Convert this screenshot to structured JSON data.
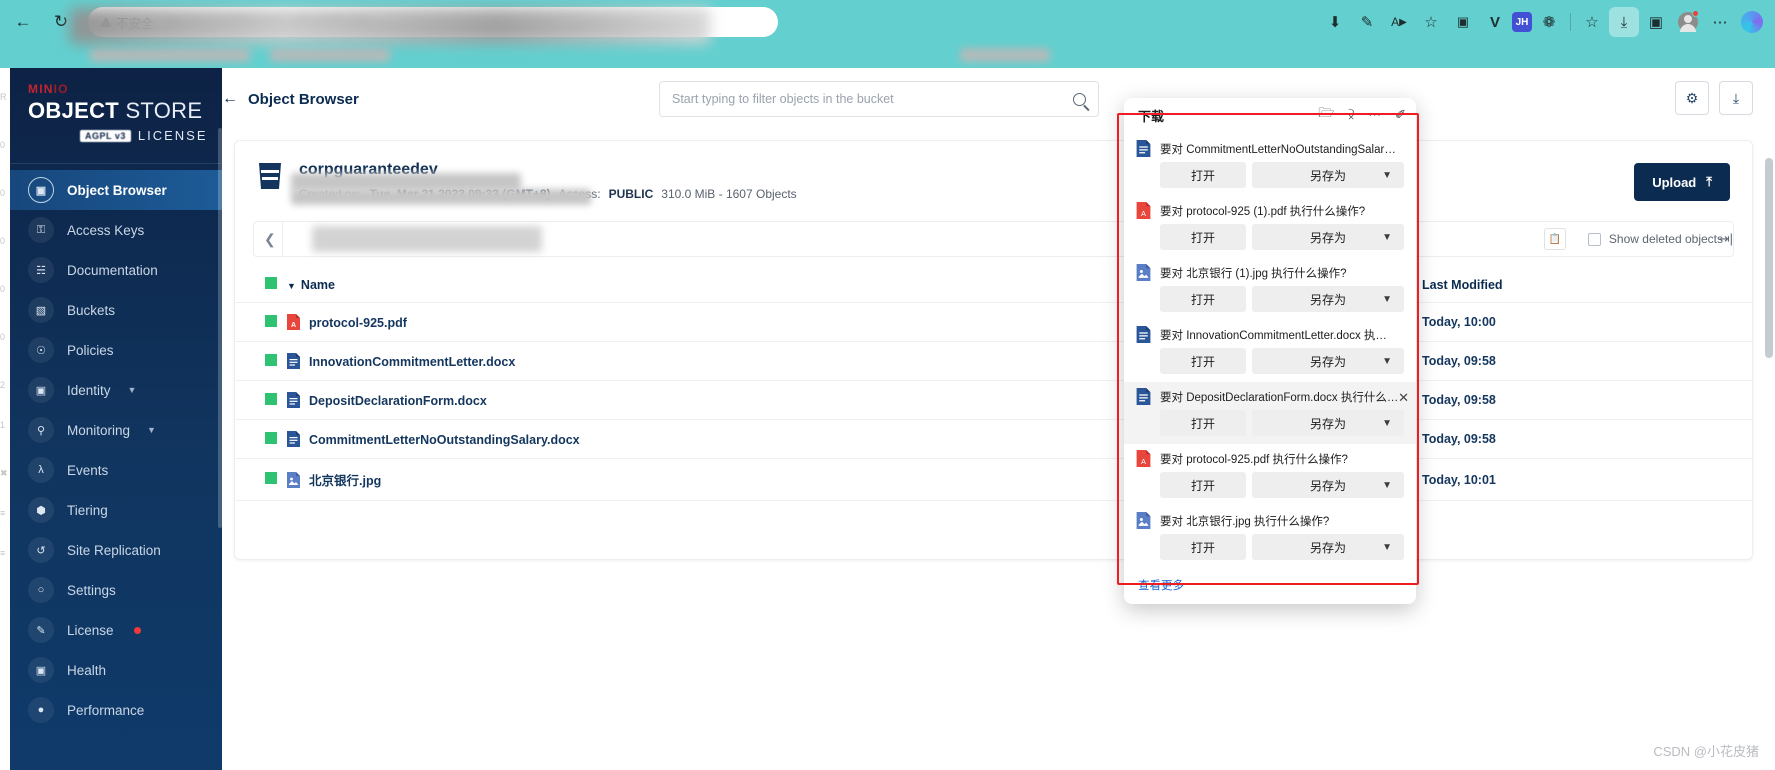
{
  "browser": {
    "nav": {
      "back": "←",
      "forward": "→",
      "reload": "↻"
    },
    "omnibox": {
      "security_label": "不安全",
      "url_text": "xxx.xxx.xxx/d3lel+elJs+aKneWGnQm...",
      "tab_hint": ""
    },
    "toolbar_icons": [
      {
        "name": "download-line-icon",
        "glyph": "⬇"
      },
      {
        "name": "pen-icon",
        "glyph": "✎"
      },
      {
        "name": "read-aloud-icon",
        "glyph": "Aᵛ"
      },
      {
        "name": "favorite-star-icon",
        "glyph": "☆"
      },
      {
        "name": "collections-icon",
        "glyph": "◱"
      },
      {
        "name": "v-extension-icon",
        "glyph": "V"
      },
      {
        "name": "jh-extension-icon",
        "glyph": "JH"
      },
      {
        "name": "puzzle-extension-icon",
        "glyph": "❁"
      },
      {
        "name": "split-screen-icon",
        "glyph": "☆"
      },
      {
        "name": "downloads-icon",
        "glyph": "⤓"
      },
      {
        "name": "browser-essentials-icon",
        "glyph": "▣"
      },
      {
        "name": "profile-avatar",
        "glyph": ""
      },
      {
        "name": "more-options-icon",
        "glyph": "⋯"
      },
      {
        "name": "copilot-icon",
        "glyph": ""
      }
    ]
  },
  "sidebar": {
    "brand": {
      "minio": "MIN",
      "minio_io": "IO",
      "title_bold": "OBJECT",
      "title_light": " STORE",
      "license_tag": "AGPL v3",
      "license_word": "LICENSE"
    },
    "items": [
      {
        "label": "Object Browser",
        "icon": "object-browser-icon",
        "active": true,
        "expandable": false,
        "dot": false
      },
      {
        "label": "Access Keys",
        "icon": "key-icon",
        "active": false,
        "expandable": false,
        "dot": false
      },
      {
        "label": "Documentation",
        "icon": "book-icon",
        "active": false,
        "expandable": false,
        "dot": false
      },
      {
        "label": "Buckets",
        "icon": "bucket-icon",
        "active": false,
        "expandable": false,
        "dot": false
      },
      {
        "label": "Policies",
        "icon": "policy-icon",
        "active": false,
        "expandable": false,
        "dot": false
      },
      {
        "label": "Identity",
        "icon": "identity-icon",
        "active": false,
        "expandable": true,
        "dot": false
      },
      {
        "label": "Monitoring",
        "icon": "monitoring-icon",
        "active": false,
        "expandable": true,
        "dot": false
      },
      {
        "label": "Events",
        "icon": "lambda-icon",
        "active": false,
        "expandable": false,
        "dot": false
      },
      {
        "label": "Tiering",
        "icon": "tiering-icon",
        "active": false,
        "expandable": false,
        "dot": false
      },
      {
        "label": "Site Replication",
        "icon": "replication-icon",
        "active": false,
        "expandable": false,
        "dot": false
      },
      {
        "label": "Settings",
        "icon": "gear-icon",
        "active": false,
        "expandable": false,
        "dot": false
      },
      {
        "label": "License",
        "icon": "license-icon",
        "active": false,
        "expandable": false,
        "dot": true
      },
      {
        "label": "Health",
        "icon": "health-icon",
        "active": false,
        "expandable": false,
        "dot": false
      },
      {
        "label": "Performance",
        "icon": "performance-icon",
        "active": false,
        "expandable": false,
        "dot": false
      }
    ]
  },
  "main": {
    "page_title": "Object Browser",
    "search": {
      "placeholder": "Start typing to filter objects in the bucket",
      "value": ""
    },
    "bucket": {
      "name": "corpguaranteedev",
      "created_label": "Created on:",
      "created_value": "Tue, Mar 21 2023 09:33 (GMT+8)",
      "access_label": "Access:",
      "access_value": "PUBLIC",
      "size_objects": "310.0 MiB - 1607 Objects"
    },
    "upload_button": "Upload",
    "show_deleted_label": "Show deleted objects",
    "table": {
      "columns": [
        "",
        "Name",
        "Last Modified"
      ],
      "rows": [
        {
          "name": "protocol-925.pdf",
          "modified": "Today, 10:00",
          "type": "pdf"
        },
        {
          "name": "InnovationCommitmentLetter.docx",
          "modified": "Today, 09:58",
          "type": "docx"
        },
        {
          "name": "DepositDeclarationForm.docx",
          "modified": "Today, 09:58",
          "type": "docx"
        },
        {
          "name": "CommitmentLetterNoOutstandingSalary.docx",
          "modified": "Today, 09:58",
          "type": "docx"
        },
        {
          "name": "北京银行.jpg",
          "modified": "Today, 10:01",
          "type": "jpg"
        }
      ]
    }
  },
  "downloads": {
    "title": "下载",
    "header_icons": [
      {
        "name": "open-folder-icon",
        "glyph": "὜1"
      },
      {
        "name": "search-icon",
        "glyph": "⚲"
      },
      {
        "name": "more-options-icon",
        "glyph": "⋯"
      },
      {
        "name": "pin-icon",
        "glyph": "✐"
      }
    ],
    "open_label": "打开",
    "saveas_label": "另存为",
    "more_label": "查看更多",
    "items": [
      {
        "text": "要对 CommitmentLetterNoOutstandingSalar…",
        "type": "docx",
        "hover": false
      },
      {
        "text": "要对 protocol-925 (1).pdf 执行什么操作?",
        "type": "pdf",
        "hover": false
      },
      {
        "text": "要对 北京银行 (1).jpg 执行什么操作?",
        "type": "jpg",
        "hover": false
      },
      {
        "text": "要对 InnovationCommitmentLetter.docx 执…",
        "type": "docx",
        "hover": false
      },
      {
        "text": "要对 DepositDeclarationForm.docx 执行什么…",
        "type": "docx",
        "hover": true
      },
      {
        "text": "要对 protocol-925.pdf 执行什么操作?",
        "type": "pdf",
        "hover": false
      },
      {
        "text": "要对 北京银行.jpg 执行什么操作?",
        "type": "jpg",
        "hover": false
      }
    ]
  },
  "watermark": "CSDN @小花皮猪",
  "colors": {
    "toolbar": "#63cfcf",
    "sidebar_top": "#0d2245",
    "accent_navy": "#0b2b50",
    "green_check": "#2ec272",
    "red_outline": "#ee1d22",
    "link_blue": "#1766c9"
  }
}
